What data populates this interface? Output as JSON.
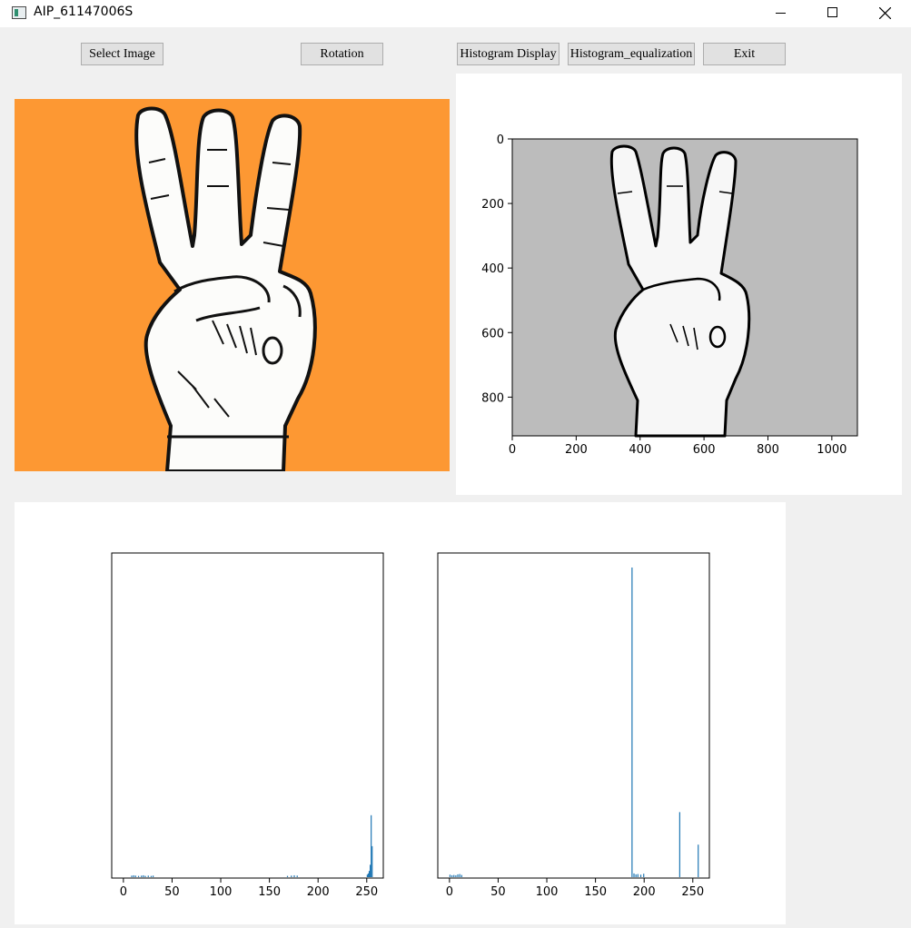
{
  "window": {
    "title": "AIP_61147006S"
  },
  "toolbar": {
    "select_image": "Select Image",
    "rotation": "Rotation",
    "histogram_display": "Histogram Display",
    "histogram_equalization": "Histogram_equalization",
    "exit": "Exit"
  },
  "colors": {
    "orange_background": "#fd9833",
    "gray_background": "#bcbcbc",
    "bar_color": "#1f77b4"
  },
  "original_image": {
    "subject": "hand showing three fingers"
  },
  "chart_data": [
    {
      "type": "scatter",
      "title": "",
      "description": "image display of processed grayscale hand",
      "xticks": [
        "0",
        "200",
        "400",
        "600",
        "800",
        "1000"
      ],
      "yticks": [
        "0",
        "200",
        "400",
        "600",
        "800"
      ],
      "xlim": [
        0,
        1080
      ],
      "ylim": [
        920,
        0
      ],
      "x": [],
      "y": []
    },
    {
      "type": "bar",
      "xticks": [
        "0",
        "50",
        "100",
        "150",
        "200",
        "250"
      ],
      "xlim": [
        -12,
        267
      ],
      "ylim": [
        0,
        100
      ],
      "x": [
        8,
        10,
        12,
        15,
        18,
        20,
        22,
        25,
        28,
        30,
        168,
        172,
        175,
        178,
        250,
        251,
        252,
        253,
        254,
        255
      ],
      "values": [
        0.5,
        0.6,
        0.5,
        0.4,
        0.5,
        0.6,
        0.4,
        0.5,
        0.4,
        0.5,
        0.4,
        0.5,
        0.6,
        0.5,
        0.8,
        1.2,
        2,
        4,
        20,
        10
      ]
    },
    {
      "type": "bar",
      "xticks": [
        "0",
        "50",
        "100",
        "150",
        "200",
        "250"
      ],
      "xlim": [
        -12,
        267
      ],
      "ylim": [
        0,
        100
      ],
      "x": [
        0,
        2,
        4,
        6,
        8,
        10,
        12,
        187,
        189,
        191,
        193,
        196,
        199,
        236,
        255
      ],
      "values": [
        0.8,
        0.6,
        0.7,
        0.6,
        0.9,
        1,
        0.7,
        100,
        1.2,
        0.9,
        1,
        0.8,
        1.1,
        21,
        10.5
      ]
    }
  ]
}
